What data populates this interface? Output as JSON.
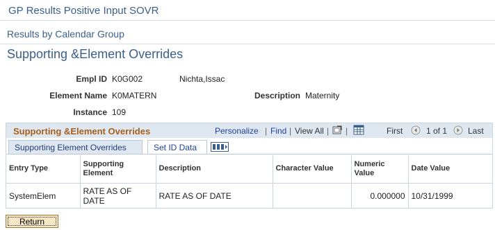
{
  "header": {
    "page_title": "GP Results Positive Input SOVR",
    "subtitle": "Results by Calendar Group",
    "heading": "Supporting &Element Overrides"
  },
  "fields": {
    "empl_id_label": "Empl ID",
    "empl_id_value": "K0G002",
    "name_value": "Nichta,Issac",
    "element_name_label": "Element Name",
    "element_name_value": "K0MATERN",
    "description_label": "Description",
    "description_value": "Maternity",
    "instance_label": "Instance",
    "instance_value": "109"
  },
  "grid": {
    "title": "Supporting &Element Overrides",
    "personalize": "Personalize",
    "find": "Find",
    "view_all": "View All",
    "first": "First",
    "range": "1 of 1",
    "last": "Last",
    "tabs": [
      "Supporting Element Overrides",
      "Set ID Data"
    ],
    "columns": [
      "Entry Type",
      "Supporting Element",
      "Description",
      "Character Value",
      "Numeric Value",
      "Date Value"
    ],
    "rows": [
      [
        "SystemElem",
        "RATE AS OF DATE",
        "RATE AS OF DATE",
        "",
        "0.000000",
        "10/31/1999"
      ]
    ]
  },
  "buttons": {
    "return_label": "Return"
  },
  "icons": {
    "zoom": "zoom-grid-icon",
    "download": "download-excel-icon",
    "prev": "previous-row-icon",
    "next": "next-row-icon",
    "show_all_columns": "show-all-columns-icon"
  },
  "colors": {
    "link": "#1f3f9c",
    "title": "#3a5f8c",
    "grid_title": "#a85f1a",
    "grid_header_bg": "#dfe7f1"
  }
}
